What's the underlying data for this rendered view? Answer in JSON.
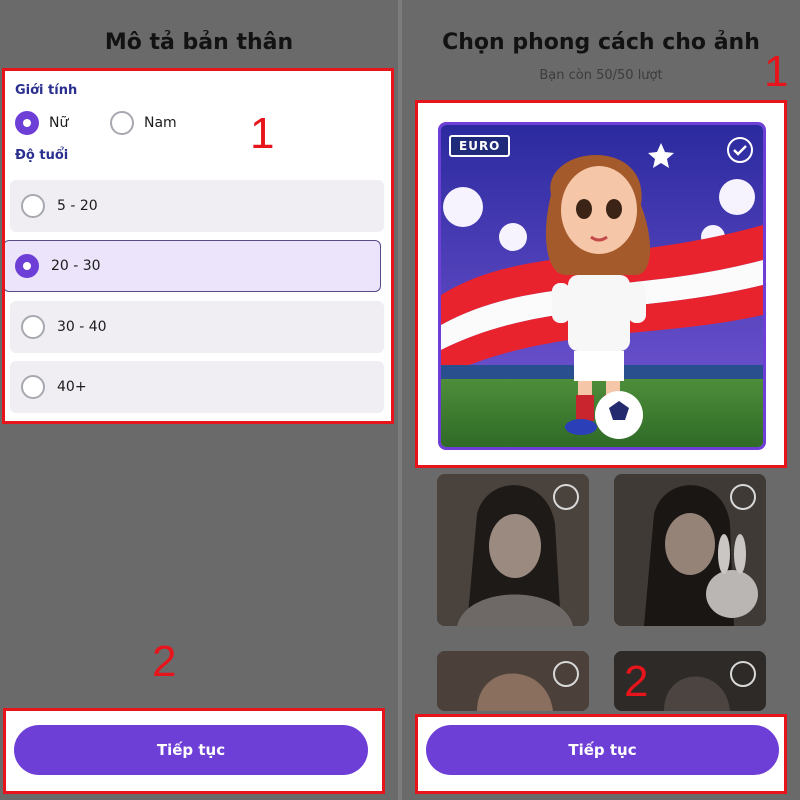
{
  "left": {
    "title": "Mô tả bản thân",
    "gender_label": "Giới tính",
    "gender_options": [
      {
        "label": "Nữ",
        "selected": true
      },
      {
        "label": "Nam",
        "selected": false
      }
    ],
    "age_label": "Độ tuổi",
    "age_options": [
      {
        "label": "5 - 20",
        "selected": false
      },
      {
        "label": "20 - 30",
        "selected": true
      },
      {
        "label": "30 - 40",
        "selected": false
      },
      {
        "label": "40+",
        "selected": false
      }
    ],
    "continue_label": "Tiếp tục"
  },
  "right": {
    "title": "Chọn phong cách cho ảnh",
    "subtitle": "Bạn còn 50/50 lượt",
    "hero_badge": "EURO",
    "styles": [
      {
        "name": "euro-football-style",
        "selected": true
      },
      {
        "name": "portrait-style-1",
        "selected": false
      },
      {
        "name": "portrait-style-rabbit",
        "selected": false
      },
      {
        "name": "portrait-style-3",
        "selected": false
      },
      {
        "name": "portrait-style-4",
        "selected": false
      }
    ],
    "continue_label": "Tiếp tục"
  },
  "annotations": {
    "left_step_1": "1",
    "left_step_2": "2",
    "right_step_1": "1",
    "right_step_2": "2"
  },
  "colors": {
    "accent": "#6e3fd6",
    "annotation": "#e8141b",
    "overlay": "#6a6a6a"
  }
}
